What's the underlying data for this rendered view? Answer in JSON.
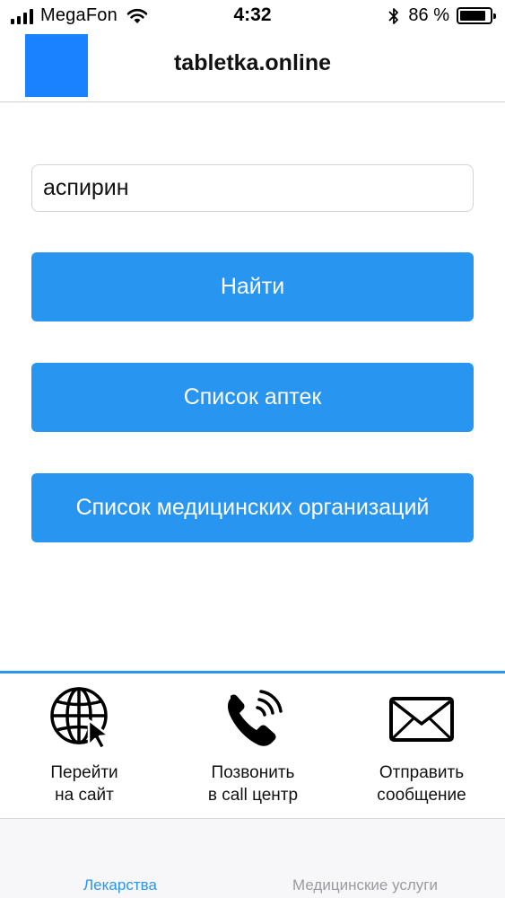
{
  "status_bar": {
    "carrier": "MegaFon",
    "time": "4:32",
    "battery_text": "86 %",
    "battery_level": 0.86,
    "icons": [
      "signal-icon",
      "wifi-icon",
      "bluetooth-icon",
      "battery-icon"
    ]
  },
  "header": {
    "title": "tabletka.online",
    "logo_color": "#1a82ff"
  },
  "form": {
    "search_value": "аспирин",
    "find_button": "Найти",
    "pharmacy_list_button": "Список аптек",
    "medical_orgs_button": "Список медицинских организаций",
    "button_color": "#2896f0"
  },
  "contacts": {
    "items": [
      {
        "icon": "globe-cursor-icon",
        "line1": "Перейти",
        "line2": "на сайт"
      },
      {
        "icon": "phone-icon",
        "line1": "Позвонить",
        "line2": "в call центр"
      },
      {
        "icon": "envelope-icon",
        "line1": "Отправить",
        "line2": "сообщение"
      }
    ]
  },
  "tabs": [
    {
      "label": "Лекарства",
      "active": true
    },
    {
      "label": "Медицинские услуги",
      "active": false
    }
  ]
}
